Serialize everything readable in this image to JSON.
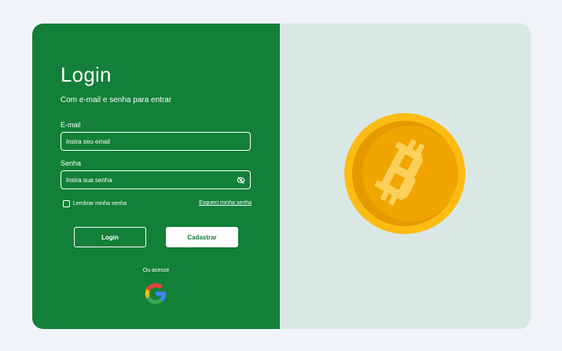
{
  "login": {
    "title": "Login",
    "subtitle": "Com e-mail e senha para entrar",
    "email_label": "E-mail",
    "email_placeholder": "Insira seu email",
    "password_label": "Senha",
    "password_placeholder": "Insira sua senha",
    "remember_label": "Lembrar minha senha",
    "forgot_label": "Esqueci minha senha",
    "login_button": "Login",
    "signup_button": "Cadastrar",
    "alt_access": "Ou acesse"
  },
  "icons": {
    "password_toggle": "eye-off-icon",
    "google": "google-logo",
    "illustration": "bitcoin-coin"
  },
  "colors": {
    "primary": "#128038",
    "panel": "#d9e8e5",
    "background": "#f0f4f8",
    "coin": "#f0a500"
  }
}
